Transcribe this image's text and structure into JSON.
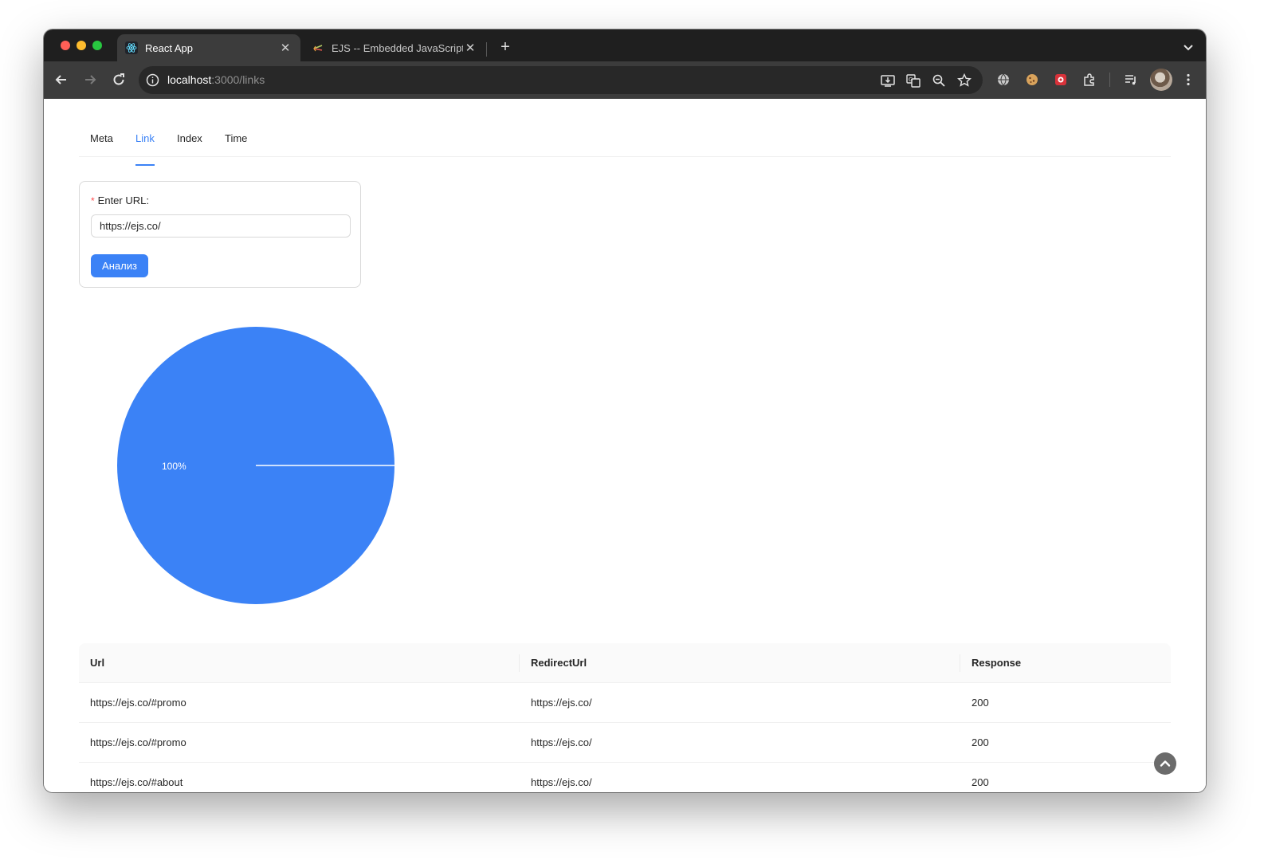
{
  "browser": {
    "tabs": [
      {
        "title": "React App",
        "active": true
      },
      {
        "title": "EJS -- Embedded JavaScript",
        "active": false
      }
    ],
    "url_host": "localhost",
    "url_rest": ":3000/links"
  },
  "page": {
    "tabs": [
      "Meta",
      "Link",
      "Index",
      "Time"
    ],
    "active_tab": "Link",
    "form": {
      "required_mark": "*",
      "label": "Enter URL:",
      "value": "https://ejs.co/",
      "button": "Анализ"
    }
  },
  "chart_data": {
    "type": "pie",
    "slices": [
      {
        "label": "100%",
        "value": 100,
        "color": "#3b82f6"
      }
    ]
  },
  "table": {
    "columns": [
      "Url",
      "RedirectUrl",
      "Response"
    ],
    "rows": [
      [
        "https://ejs.co/#promo",
        "https://ejs.co/",
        "200"
      ],
      [
        "https://ejs.co/#promo",
        "https://ejs.co/",
        "200"
      ],
      [
        "https://ejs.co/#about",
        "https://ejs.co/",
        "200"
      ]
    ]
  },
  "colors": {
    "accent": "#3b82f6",
    "required": "#ff4d4f"
  }
}
